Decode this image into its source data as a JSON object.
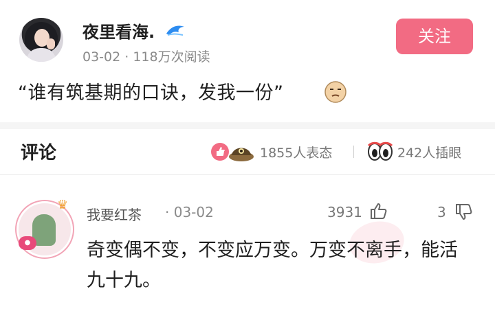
{
  "post": {
    "author": "夜里看海.",
    "meta": "03-02 · 118万次阅读",
    "follow_label": "关注",
    "text": "“谁有筑基期的口诀，发我一份”"
  },
  "comments_section": {
    "title": "评论",
    "reactions_count": "1855人表态",
    "eyes_count": "242人插眼"
  },
  "comment": {
    "author": "我要红茶",
    "date": "· 03-02",
    "likes": "3931",
    "dislikes": "3",
    "text": "奇变偶不变，不变应万变。万变不离手，能活九十九。"
  },
  "colors": {
    "accent": "#f26b83",
    "muted_text": "#8a8a8a",
    "divider": "#ececec"
  },
  "icons": {
    "post_author_badge": "wave-icon",
    "post_emoji": "face-emoji-icon",
    "reactions": [
      "thumbs-up-icon",
      "hat-emoji-icon"
    ],
    "eyes": "eyes-icon",
    "like": "thumbs-up-outline-icon",
    "dislike": "thumbs-down-outline-icon"
  }
}
